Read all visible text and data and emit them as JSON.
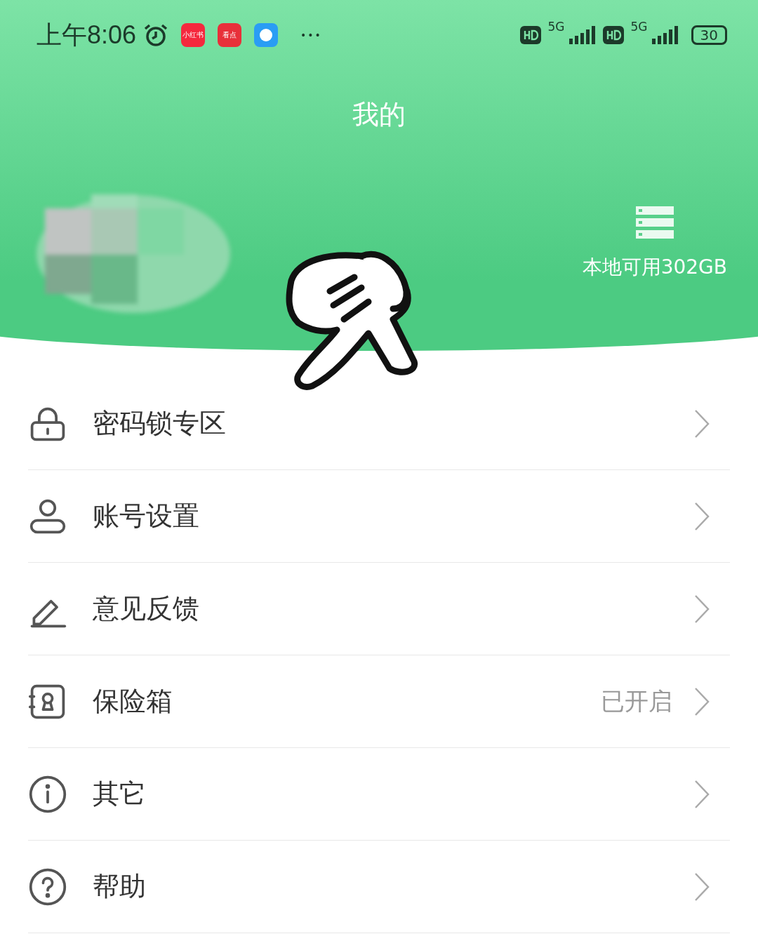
{
  "status_bar": {
    "time": "上午8:06",
    "apps": [
      {
        "label": "小红书",
        "color": "#f5283d"
      },
      {
        "label": "看点",
        "color": "#e8303a"
      },
      {
        "color": "#2a9df4"
      }
    ],
    "more": "•••",
    "sims": [
      {
        "network": "5G"
      },
      {
        "network": "5G"
      }
    ],
    "battery": "30"
  },
  "header": {
    "title": "我的",
    "storage": "本地可用302GB"
  },
  "menu": [
    {
      "kind": "lock",
      "label": "密码锁专区"
    },
    {
      "kind": "user",
      "label": "账号设置"
    },
    {
      "kind": "pen",
      "label": "意见反馈"
    },
    {
      "kind": "safe",
      "label": "保险箱",
      "value": "已开启"
    },
    {
      "kind": "info",
      "label": "其它"
    },
    {
      "kind": "help",
      "label": "帮助"
    }
  ]
}
